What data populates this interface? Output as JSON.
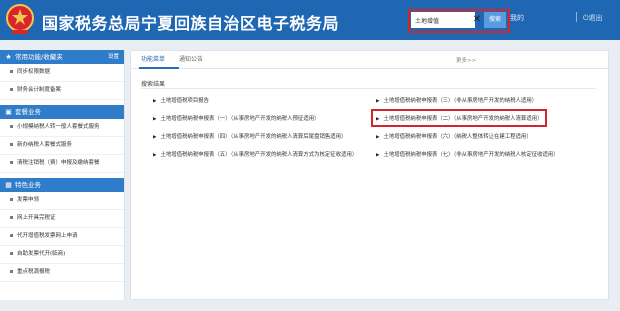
{
  "header": {
    "title": "国家税务总局宁夏回族自治区电子税务局",
    "search": {
      "value": "土地增值",
      "button": "搜索"
    },
    "links": {
      "account": "我的",
      "logout": "退出"
    },
    "colors": {
      "bar": "#1f66b3",
      "highlight": "#d0262c"
    }
  },
  "sidebar": {
    "sections": [
      {
        "title": "常用功能/收藏夹",
        "action": "设置",
        "icon": "star-icon",
        "items": [
          "同步权限数据",
          "财务会计制度备案"
        ]
      },
      {
        "title": "套餐业务",
        "icon": "package-icon",
        "items": [
          "小规模纳税人转一般人套餐式服务",
          "新办纳税人套餐式服务",
          "清税注销税（费）申报及缴纳套餐"
        ]
      },
      {
        "title": "特色业务",
        "icon": "grid-icon",
        "items": [
          "发票申领",
          "网上开具完税证",
          "代开增值税发票网上申请",
          "自助发票代开(临商)",
          "重点税源报税"
        ]
      }
    ]
  },
  "main": {
    "tabs": [
      "功能菜单",
      "通知公告"
    ],
    "more": "更多>>",
    "results_title": "搜索结果",
    "results_left": [
      "土地增值税项目报告",
      "土地增值税纳税申报表（一）（从事房地产开发的纳税人预征适用）",
      "土地增值税纳税申报表（四）（从事房地产开发的纳税人清算后尾盘销售适用）",
      "土地增值税纳税申报表（五）（从事房地产开发的纳税人清算方式为核定征收适用）"
    ],
    "results_right": [
      "土地增值税纳税申报表（三）（非从事房地产开发的纳税人适用）",
      "土地增值税纳税申报表（二）（从事房地产开发的纳税人清算适用）",
      "土地增值税纳税申报表（六）（纳税人整体转让在建工程适用）",
      "土地增值税纳税申报表（七）（非从事房地产开发的纳税人核定征收适用）"
    ]
  }
}
